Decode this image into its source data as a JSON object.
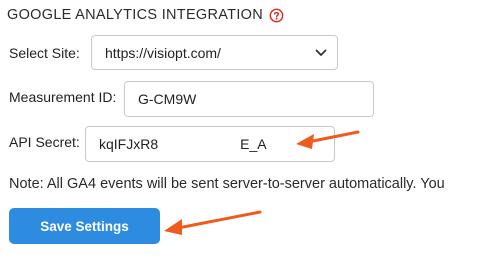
{
  "section": {
    "title": "GOOGLE ANALYTICS INTEGRATION",
    "help_icon": "question-circle-icon",
    "help_color": "#e0251b"
  },
  "form": {
    "site": {
      "label": "Select Site:",
      "value": "https://visiopt.com/"
    },
    "measurement_id": {
      "label": "Measurement ID:",
      "value_visible_prefix": "G-CM9W"
    },
    "api_secret": {
      "label": "API Secret:",
      "value_visible_prefix": "kqIFJxR8",
      "value_visible_suffix": "E_A"
    }
  },
  "note": "Note: All GA4 events will be sent server-to-server automatically. You",
  "save_button": {
    "label": "Save Settings",
    "color": "#2d8be0"
  },
  "annotation": {
    "arrow_color": "#ef5a1e"
  }
}
